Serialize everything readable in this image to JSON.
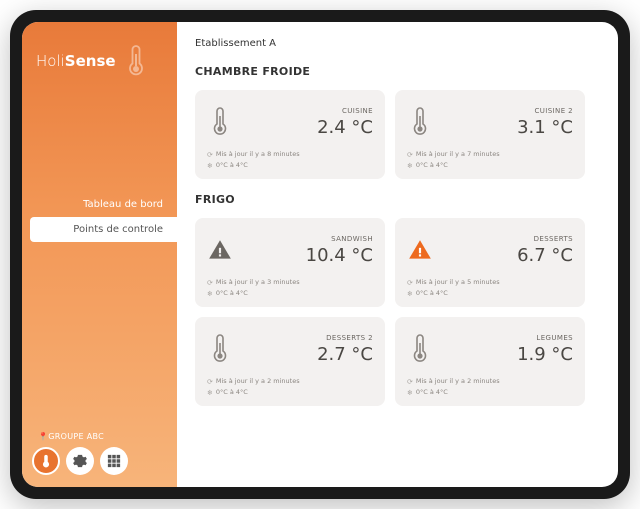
{
  "brand": {
    "name_light": "Holi",
    "name_bold": "Sense"
  },
  "nav": {
    "dashboard": "Tableau de bord",
    "control_points": "Points de controle"
  },
  "footer": {
    "group": "GROUPE ABC"
  },
  "establishment": "Etablissement A",
  "sections": [
    {
      "title": "CHAMBRE FROIDE",
      "cards": [
        {
          "label": "CUISINE",
          "temp": "2.4 °C",
          "updated": "Mis à jour il y a 8 minutes",
          "range": "0°C à 4°C",
          "status": "ok"
        },
        {
          "label": "CUISINE 2",
          "temp": "3.1 °C",
          "updated": "Mis à jour il y a 7 minutes",
          "range": "0°C à 4°C",
          "status": "ok"
        }
      ]
    },
    {
      "title": "FRIGO",
      "cards": [
        {
          "label": "SANDWISH",
          "temp": "10.4 °C",
          "updated": "Mis à jour il y a 3 minutes",
          "range": "0°C à 4°C",
          "status": "warn-grey"
        },
        {
          "label": "DESSERTS",
          "temp": "6.7 °C",
          "updated": "Mis à jour il y a 5 minutes",
          "range": "0°C à 4°C",
          "status": "warn-orange"
        },
        {
          "label": "DESSERTS 2",
          "temp": "2.7 °C",
          "updated": "Mis à jour il y a 2 minutes",
          "range": "0°C à 4°C",
          "status": "ok"
        },
        {
          "label": "LEGUMES",
          "temp": "1.9 °C",
          "updated": "Mis à jour il y a 2 minutes",
          "range": "0°C à 4°C",
          "status": "ok"
        }
      ]
    }
  ]
}
